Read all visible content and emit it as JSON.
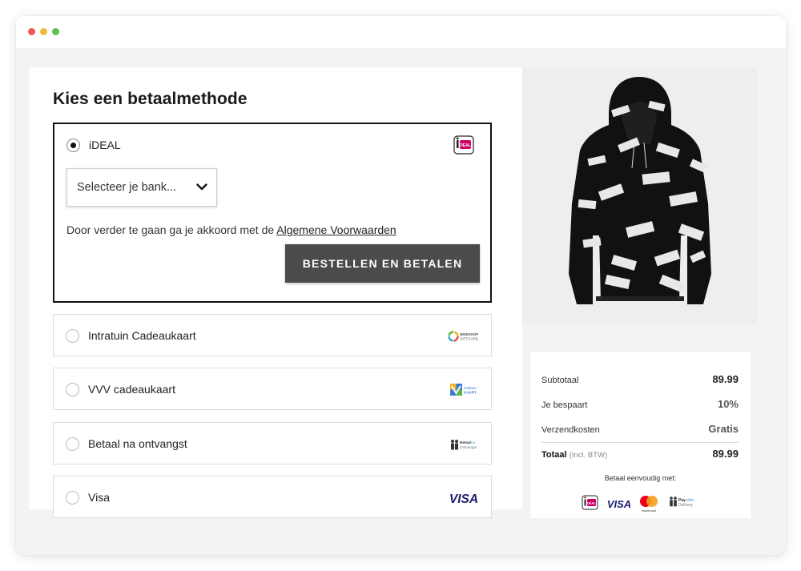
{
  "window": {
    "controls": [
      "close",
      "minimize",
      "maximize"
    ]
  },
  "checkout": {
    "heading": "Kies een betaalmethode",
    "active_method": {
      "label": "iDEAL",
      "logo_icon": "ideal-logo-icon",
      "bank_select": {
        "value": "Selecteer je bank..."
      },
      "terms_prefix": "Door verder te gaan ga je akkoord met de",
      "terms_link": "Algemene Voorwaarden",
      "pay_button": "BESTELLEN EN BETALEN"
    },
    "methods": [
      {
        "label": "Intratuin Cadeaukaart",
        "logo_icon": "webshop-giftcard-logo-icon",
        "logo_text": "WEBSHOP GIFTCARD"
      },
      {
        "label": "VVV cadeaukaart",
        "logo_icon": "vvv-cadeaukaart-logo-icon",
        "logo_text": "Cadeau KAART"
      },
      {
        "label": "Betaal na ontvangst",
        "logo_icon": "betaal-na-ontvangst-logo-icon",
        "logo_text": "Betaal na Ontvangst"
      },
      {
        "label": "Visa",
        "logo_icon": "visa-logo-icon",
        "logo_text": "VISA"
      }
    ]
  },
  "product": {
    "image_icon": "black-printed-hoodie-image"
  },
  "summary": {
    "subtotal_label": "Subtotaal",
    "subtotal_value": "89.99",
    "discount_label": "Je bespaart",
    "discount_value": "10%",
    "shipping_label": "Verzendkosten",
    "shipping_value": "Gratis",
    "total_label": "Totaal",
    "total_note": "(Incl. BTW)",
    "total_value": "89.99",
    "pay_easy": "Betaal eenvoudig met:",
    "pay_logos": [
      "ideal-logo-icon",
      "visa-logo-icon",
      "mastercard-logo-icon",
      "payafter-delivery-logo-icon"
    ],
    "mastercard_text": "mastercard",
    "payafter_text": "Pay after Delivery",
    "visa_text": "VISA",
    "ideal_text": "iDEAL"
  },
  "colors": {
    "button": "#4b4b4d",
    "border_active": "#111111",
    "ideal": "#cc0066",
    "visa": "#1a1f71",
    "mc_red": "#eb001b",
    "mc_orange": "#f79e1b"
  }
}
